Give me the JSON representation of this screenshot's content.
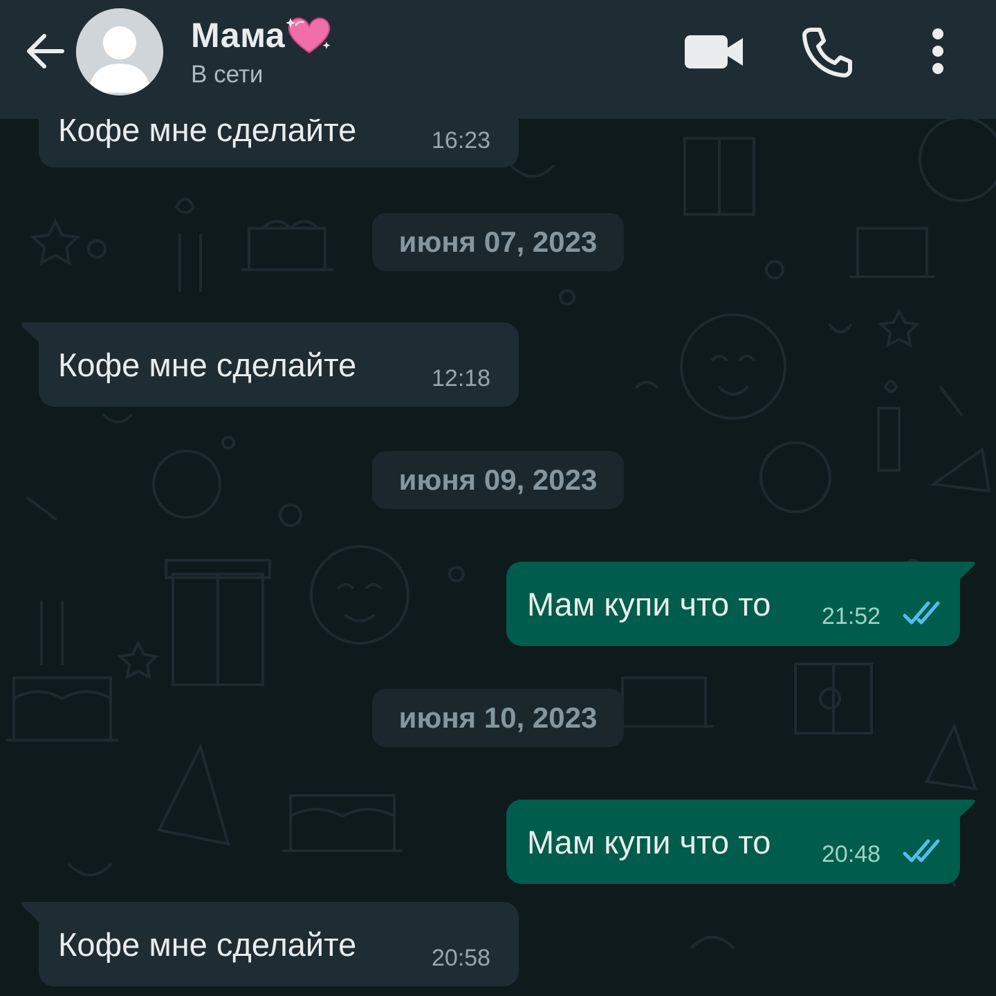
{
  "header": {
    "back_icon": "arrow-left-icon",
    "avatar_icon": "default-avatar-icon",
    "contact_name": "Мама",
    "name_emoji_icon": "sparkling-heart-icon",
    "status": "В сети",
    "video_icon": "video-camera-icon",
    "call_icon": "phone-icon",
    "menu_icon": "more-vertical-icon"
  },
  "messages": [
    {
      "direction": "incoming",
      "text": "Кофе мне сделайте",
      "time": "16:23"
    },
    {
      "type": "date",
      "text": "июня 07, 2023"
    },
    {
      "direction": "incoming",
      "text": "Кофе мне сделайте",
      "time": "12:18"
    },
    {
      "type": "date",
      "text": "июня 09, 2023"
    },
    {
      "direction": "outgoing",
      "text": "Мам купи что то",
      "time": "21:52",
      "status_icon": "double-check-read-icon"
    },
    {
      "type": "date",
      "text": "июня 10, 2023"
    },
    {
      "direction": "outgoing",
      "text": "Мам купи что то",
      "time": "20:48",
      "status_icon": "double-check-read-icon"
    },
    {
      "direction": "incoming",
      "text": "Кофе мне сделайте",
      "time": "20:58"
    }
  ],
  "colors": {
    "header_bg": "#1f2c33",
    "chat_bg": "#0f1a1d",
    "incoming_bubble": "#1f2c33",
    "outgoing_bubble": "#005c4b",
    "read_tick": "#53bdeb"
  }
}
